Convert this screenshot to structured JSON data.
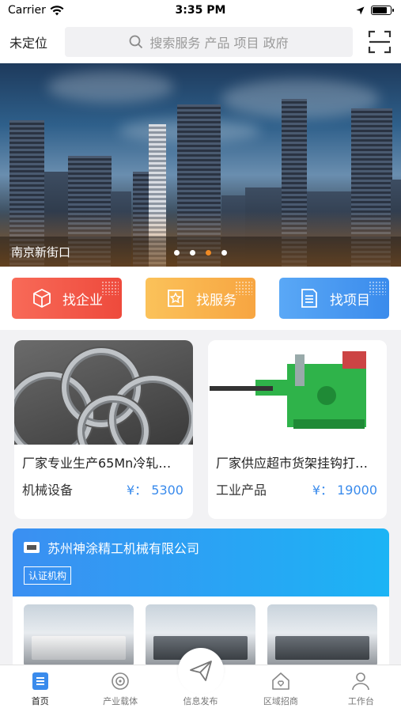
{
  "status_bar": {
    "carrier": "Carrier",
    "time": "3:35 PM",
    "battery_level": 0.9
  },
  "header": {
    "location": "未定位",
    "search_placeholder": "搜索服务 产品 项目 政府"
  },
  "banner": {
    "caption": "南京新街口",
    "slide_count": 4,
    "active_slide": 3
  },
  "quick_actions": [
    {
      "label": "找企业",
      "icon": "cube-icon",
      "color": "#ef5244"
    },
    {
      "label": "找服务",
      "icon": "star-badge-icon",
      "color": "#f9b14c"
    },
    {
      "label": "找项目",
      "icon": "list-doc-icon",
      "color": "#4698f0"
    }
  ],
  "products": [
    {
      "title": "厂家专业生产65Mn冷轧…",
      "category": "机械设备",
      "price": "¥： 5300"
    },
    {
      "title": "厂家供应超市货架挂钩打…",
      "category": "工业产品",
      "price": "¥： 19000"
    }
  ],
  "company": {
    "name": "苏州神涂精工机械有限公司",
    "tag": "认证机构"
  },
  "tabs": [
    {
      "label": "首页",
      "icon": "home-grid-icon",
      "active": true
    },
    {
      "label": "产业载体",
      "icon": "signal-tower-icon",
      "active": false
    },
    {
      "label": "信息发布",
      "icon": "paper-plane-icon",
      "active": false
    },
    {
      "label": "区域招商",
      "icon": "house-heart-icon",
      "active": false
    },
    {
      "label": "工作台",
      "icon": "user-icon",
      "active": false
    }
  ],
  "colors": {
    "accent": "#3a8bec",
    "price": "#3a8bec",
    "active_dot": "#f08a24"
  }
}
